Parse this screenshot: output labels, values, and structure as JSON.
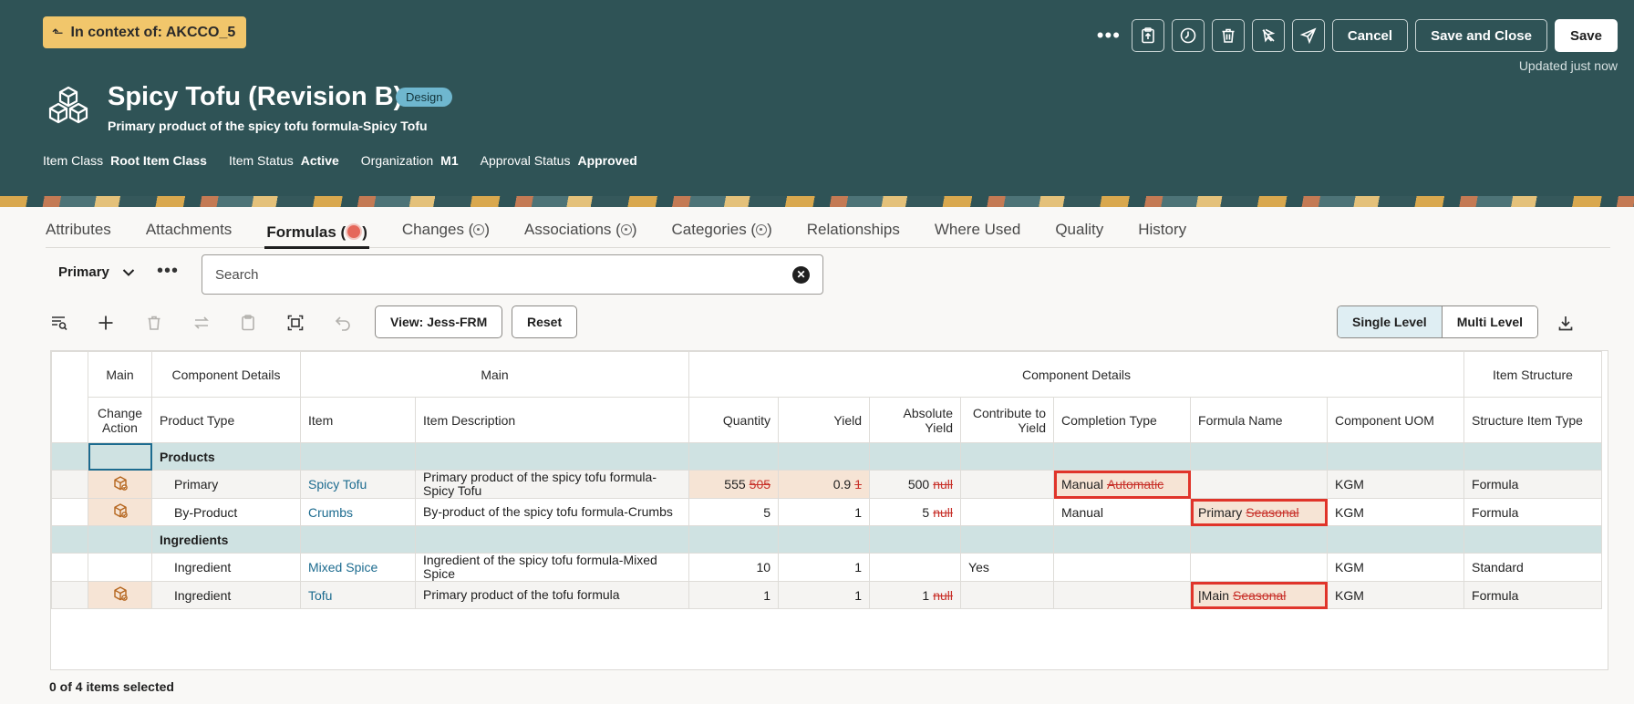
{
  "header": {
    "context_badge": "In context of: AKCCO_5",
    "title": "Spicy Tofu (Revision B)",
    "lifecycle_badge": "Design",
    "subtitle": "Primary product of the spicy tofu formula-Spicy Tofu",
    "updated": "Updated just now",
    "meta": [
      {
        "label": "Item Class",
        "value": "Root Item Class"
      },
      {
        "label": "Item Status",
        "value": "Active"
      },
      {
        "label": "Organization",
        "value": "M1"
      },
      {
        "label": "Approval Status",
        "value": "Approved"
      }
    ],
    "actions": {
      "more": "•••",
      "cancel": "Cancel",
      "save_close": "Save and Close",
      "save": "Save"
    }
  },
  "tabs": [
    {
      "label": "Attributes"
    },
    {
      "label": "Attachments"
    },
    {
      "label": "Formulas ("
    },
    {
      "label": "Changes ("
    },
    {
      "label": "Associations ("
    },
    {
      "label": "Categories ("
    },
    {
      "label": "Relationships"
    },
    {
      "label": "Where Used"
    },
    {
      "label": "Quality"
    },
    {
      "label": "History"
    }
  ],
  "tab_close": ")",
  "filter": {
    "structure": "Primary",
    "more": "•••",
    "search_placeholder": "Search"
  },
  "table_toolbar": {
    "view": "View: Jess-FRM",
    "reset": "Reset",
    "single_level": "Single Level",
    "multi_level": "Multi Level"
  },
  "grid": {
    "groups": [
      "Main",
      "Component Details",
      "Main",
      "Component Details",
      "Item Structure"
    ],
    "columns": [
      "Change Action",
      "Product Type",
      "Item",
      "Item Description",
      "Quantity",
      "Yield",
      "Absolute Yield",
      "Contribute to Yield",
      "Completion Type",
      "Formula Name",
      "Component UOM",
      "Structure Item Type"
    ],
    "section_products": "Products",
    "section_ingredients": "Ingredients",
    "rows": [
      {
        "type": "Primary",
        "item": "Spicy Tofu",
        "desc": "Primary product of the spicy tofu formula-Spicy Tofu",
        "qty": "555",
        "qty_old": "505",
        "yield": "0.9",
        "yield_old": "1",
        "abs": "500",
        "abs_old": "null",
        "contrib": "",
        "completion": "Manual",
        "completion_old": "Automatic",
        "formula": "",
        "formula_old": "",
        "uom": "KGM",
        "sit": "Formula"
      },
      {
        "type": "By-Product",
        "item": "Crumbs",
        "desc": "By-product of the spicy tofu formula-Crumbs",
        "qty": "5",
        "qty_old": "",
        "yield": "1",
        "yield_old": "",
        "abs": "5",
        "abs_old": "null",
        "contrib": "",
        "completion": "Manual",
        "completion_old": "",
        "formula": "Primary",
        "formula_old": "Seasonal",
        "uom": "KGM",
        "sit": "Formula"
      },
      {
        "type": "Ingredient",
        "item": "Mixed Spice",
        "desc": "Ingredient of the spicy tofu formula-Mixed Spice",
        "qty": "10",
        "qty_old": "",
        "yield": "1",
        "yield_old": "",
        "abs": "",
        "abs_old": "",
        "contrib": "Yes",
        "completion": "",
        "completion_old": "",
        "formula": "",
        "formula_old": "",
        "uom": "KGM",
        "sit": "Standard"
      },
      {
        "type": "Ingredient",
        "item": "Tofu",
        "desc": "Primary product of the tofu formula",
        "qty": "1",
        "qty_old": "",
        "yield": "1",
        "yield_old": "",
        "abs": "1",
        "abs_old": "null",
        "contrib": "",
        "completion": "",
        "completion_old": "",
        "formula": "|Main",
        "formula_old": "Seasonal",
        "uom": "KGM",
        "sit": "Formula"
      }
    ]
  },
  "footer": "0 of 4 items selected",
  "colors": {
    "header": "#2f5356",
    "accent": "#f1c66b",
    "highlight": "#e0342a",
    "link": "#1c6b8f",
    "group_row": "#cfe2e2"
  }
}
